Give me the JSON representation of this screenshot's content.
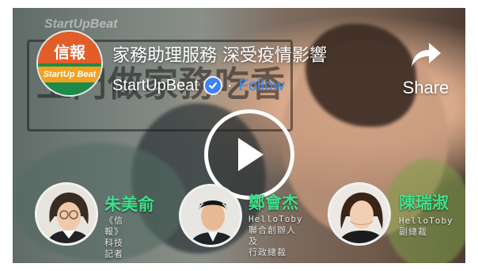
{
  "video": {
    "title": "家務助理服務 深受疫情影響",
    "channel_name": "StartUpBeat",
    "follow_label": "Follow",
    "share_label": "Share",
    "watermark": "StartUpBeat",
    "background_sign_text": "上門做家務吃香"
  },
  "logo": {
    "top_text": "信報",
    "band_text": "StartUp Beat"
  },
  "guests": [
    {
      "name": "朱美俞",
      "role": "《信報》\n科技記者"
    },
    {
      "name": "鄭會杰",
      "role": "HelloToby\n聯合創辦人及\n行政總裁"
    },
    {
      "name": "陳瑞淑",
      "role": "HelloToby\n副總裁"
    }
  ],
  "colors": {
    "accent_follow": "#3b8bf0",
    "guest_name": "#3fe08a",
    "verified": "#3b82f6"
  },
  "icons": [
    "verified-badge-icon",
    "share-arrow-icon",
    "play-icon"
  ]
}
